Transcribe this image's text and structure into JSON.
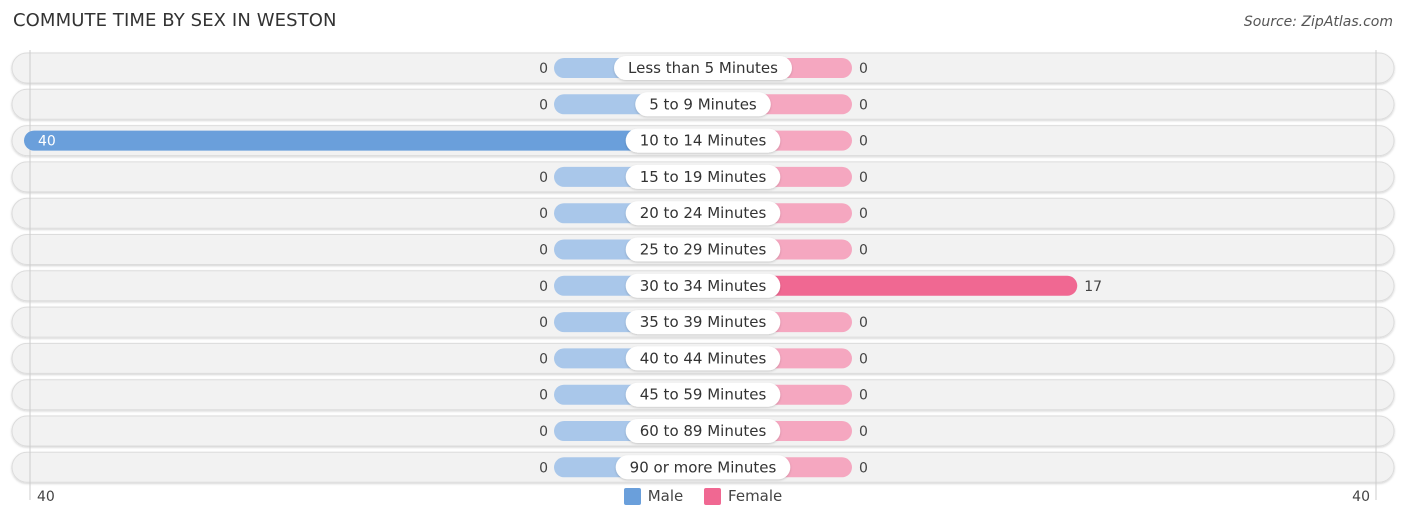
{
  "header": {
    "title": "COMMUTE TIME BY SEX IN WESTON",
    "source": "Source: ZipAtlas.com"
  },
  "colors": {
    "male": "#6a9fdb",
    "male_light": "#a9c7ea",
    "female": "#f06892",
    "female_light": "#f5a7c0",
    "track": "#f2f2f2"
  },
  "chart_data": {
    "type": "bar",
    "orientation": "horizontal-diverging",
    "title": "COMMUTE TIME BY SEX IN WESTON",
    "categories": [
      "Less than 5 Minutes",
      "5 to 9 Minutes",
      "10 to 14 Minutes",
      "15 to 19 Minutes",
      "20 to 24 Minutes",
      "25 to 29 Minutes",
      "30 to 34 Minutes",
      "35 to 39 Minutes",
      "40 to 44 Minutes",
      "45 to 59 Minutes",
      "60 to 89 Minutes",
      "90 or more Minutes"
    ],
    "series": [
      {
        "name": "Male",
        "values": [
          0,
          0,
          40,
          0,
          0,
          0,
          0,
          0,
          0,
          0,
          0,
          0
        ]
      },
      {
        "name": "Female",
        "values": [
          0,
          0,
          0,
          0,
          0,
          0,
          17,
          0,
          0,
          0,
          0,
          0
        ]
      }
    ],
    "axis": {
      "left_label": "40",
      "right_label": "40",
      "max": 40
    },
    "legend": {
      "position": "bottom-center",
      "entries": [
        "Male",
        "Female"
      ]
    }
  }
}
